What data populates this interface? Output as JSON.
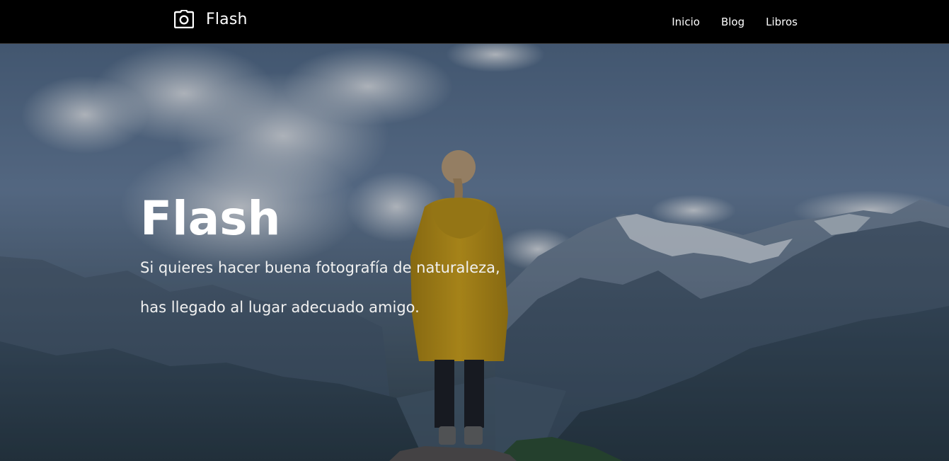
{
  "header": {
    "brand_icon": "camera-icon",
    "brand_name": "Flash",
    "nav": [
      {
        "label": "Inicio"
      },
      {
        "label": "Blog"
      },
      {
        "label": "Libros"
      }
    ]
  },
  "hero": {
    "title": "Flash",
    "line1": "Si quieres hacer buena fotografía de naturaleza,",
    "line2": "has llegado al lugar adecuado amigo."
  },
  "colors": {
    "navbar": "#000000",
    "text": "#ffffff",
    "jacket": "#d9a50f"
  }
}
